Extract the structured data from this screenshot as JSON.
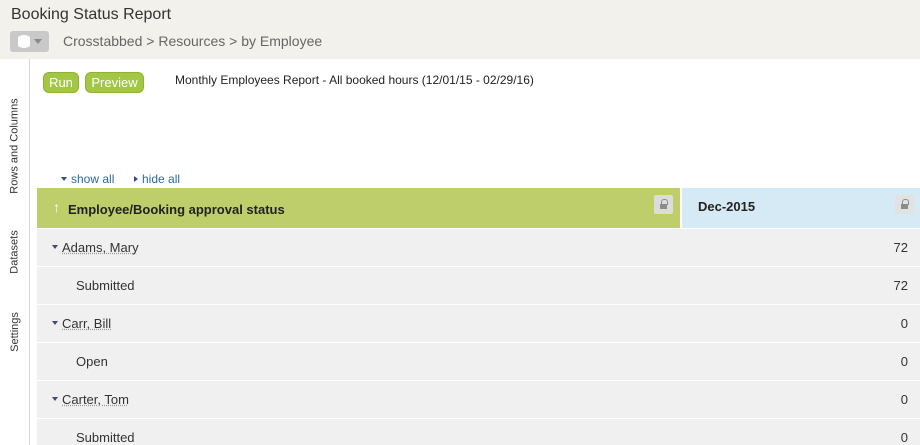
{
  "header": {
    "title": "Booking Status Report",
    "breadcrumb": "Crosstabbed > Resources > by Employee"
  },
  "side_tabs": {
    "rows_and_columns": "Rows and Columns",
    "datasets": "Datasets",
    "settings": "Settings"
  },
  "toolbar": {
    "run_label": "Run",
    "preview_label": "Preview",
    "report_title": "Monthly Employees Report - All booked hours (12/01/15 - 02/29/16)"
  },
  "controls": {
    "show_all": "show all",
    "hide_all": "hide all"
  },
  "table": {
    "row_header": "Employee/Booking approval status",
    "column_header": "Dec-2015",
    "rows": [
      {
        "type": "employee",
        "label": "Adams, Mary",
        "value": "72"
      },
      {
        "type": "status",
        "label": "Submitted",
        "value": "72"
      },
      {
        "type": "employee",
        "label": "Carr, Bill",
        "value": "0"
      },
      {
        "type": "status",
        "label": "Open",
        "value": "0"
      },
      {
        "type": "employee",
        "label": "Carter, Tom",
        "value": "0"
      },
      {
        "type": "status",
        "label": "Submitted",
        "value": "0"
      }
    ]
  },
  "colors": {
    "accent_green": "#a3c644",
    "row_header_bg": "#bece6a",
    "column_header_bg": "#d6eaf5",
    "row_bg": "#f0f0f0",
    "link_blue": "#2c6c9b"
  }
}
